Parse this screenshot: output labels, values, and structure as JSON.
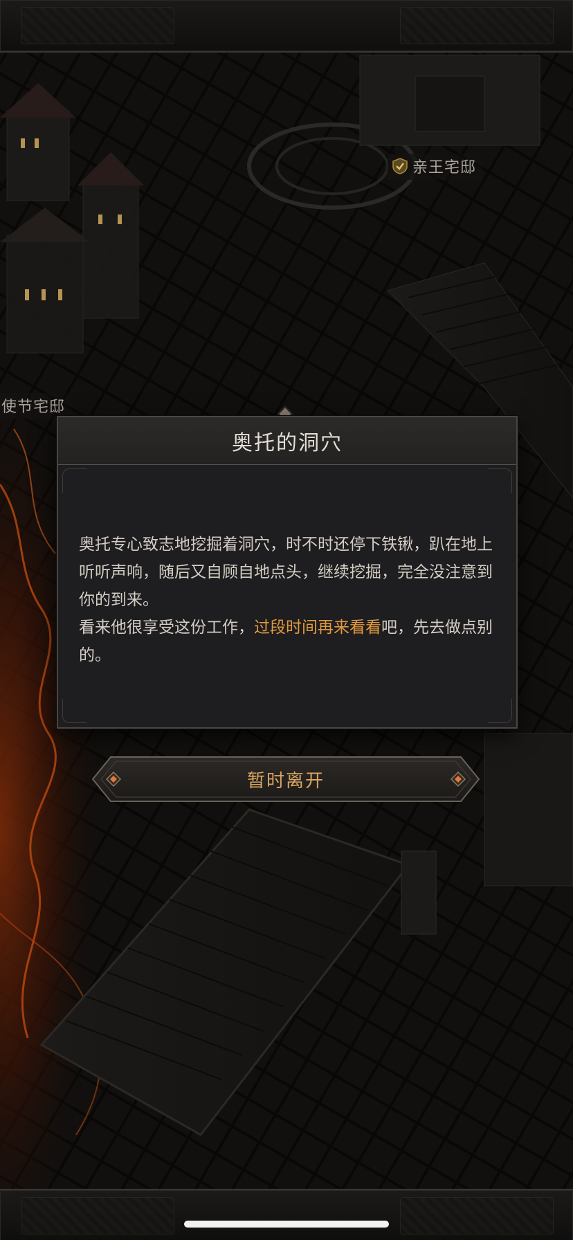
{
  "map": {
    "locations": [
      {
        "label": "亲王宅邸",
        "checked": true
      },
      {
        "label": "使节宅邸",
        "checked": false
      }
    ]
  },
  "dialog": {
    "title": "奥托的洞穴",
    "paragraph1": "奥托专心致志地挖掘着洞穴，时不时还停下铁锹，趴在地上听听声响，随后又自顾自地点头，继续挖掘，完全没注意到你的到来。",
    "paragraph2_before": "看来他很享受这份工作，",
    "paragraph2_highlight": "过段时间再来看看",
    "paragraph2_after": "吧，先去做点别的。"
  },
  "actions": {
    "leave_label": "暂时离开"
  },
  "colors": {
    "highlight": "#e09a3f",
    "button_text": "#d9a55f",
    "lava": "#c2410c"
  }
}
